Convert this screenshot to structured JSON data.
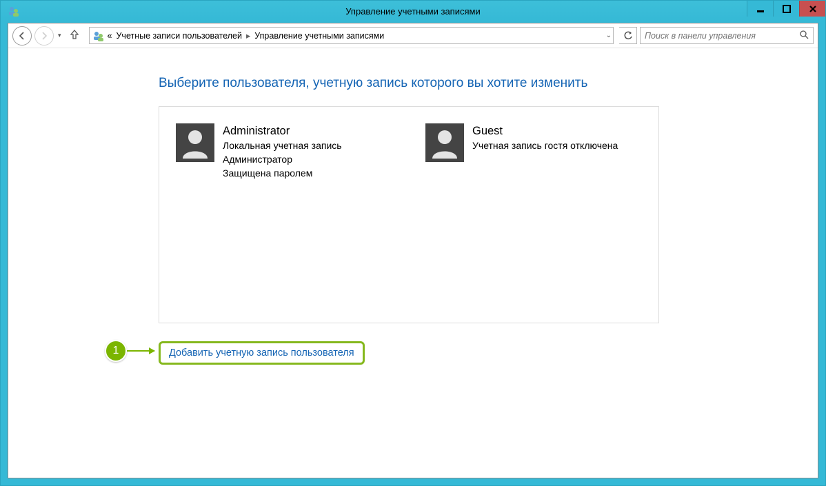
{
  "window": {
    "title": "Управление учетными записями"
  },
  "breadcrumb": {
    "prefix": "«",
    "items": [
      "Учетные записи пользователей",
      "Управление учетными записями"
    ]
  },
  "search": {
    "placeholder": "Поиск в панели управления"
  },
  "main": {
    "heading": "Выберите пользователя, учетную запись которого вы хотите изменить",
    "users": [
      {
        "name": "Administrator",
        "lines": [
          "Локальная учетная запись",
          "Администратор",
          "Защищена паролем"
        ]
      },
      {
        "name": "Guest",
        "lines": [
          "Учетная запись гостя отключена"
        ]
      }
    ],
    "add_link": "Добавить учетную запись пользователя"
  },
  "callout": {
    "number": "1"
  }
}
